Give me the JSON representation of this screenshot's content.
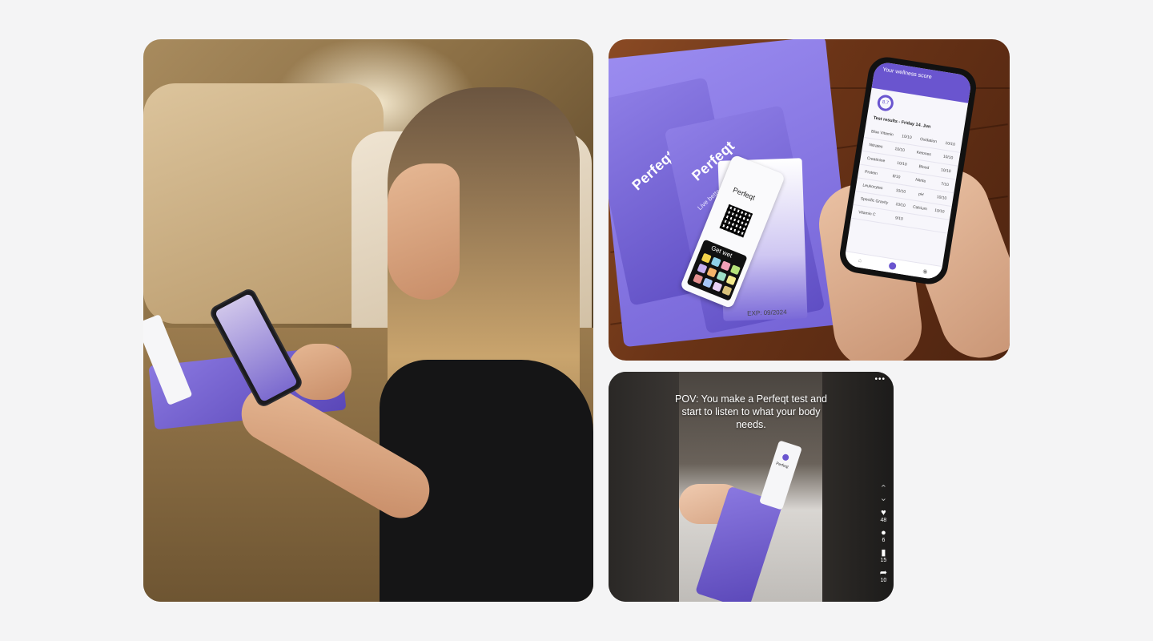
{
  "images": {
    "main": {
      "label": "Woman scanning test strip with phone"
    },
    "kit": {
      "brand": "Perfeqt",
      "tagline": "Live better. Live longer.",
      "strip_brand": "Perfeqt",
      "strip_cta": "Get wet",
      "expiry": "EXP: 09/2024",
      "app": {
        "score_title": "Your wellness score",
        "score": "8.7",
        "results_title": "Test results - Friday 14. Jun",
        "rows": [
          [
            "Blue Vitamin",
            "10/10",
            "Oxidation",
            "10/10"
          ],
          [
            "Nitrates",
            "10/10",
            "Ketones",
            "10/10"
          ],
          [
            "Creatinine",
            "10/10",
            "Blood",
            "10/10"
          ],
          [
            "Protein",
            "8/10",
            "Nitrite",
            "7/10"
          ],
          [
            "Leukocytes",
            "10/10",
            "pH",
            "10/10"
          ],
          [
            "Specific Gravity",
            "10/10",
            "Calcium",
            "10/10"
          ],
          [
            "Vitamin C",
            "9/10",
            "",
            ""
          ]
        ]
      }
    },
    "video": {
      "more": "•••",
      "caption": "POV: You make a Perfeqt test and start to listen to what your body needs.",
      "strip_brand": "Perfeqt",
      "likes": "48",
      "comments": "6",
      "saves": "15",
      "shares": "10"
    }
  },
  "colors": {
    "brand_purple": "#6a55cf",
    "background": "#f4f4f5"
  }
}
